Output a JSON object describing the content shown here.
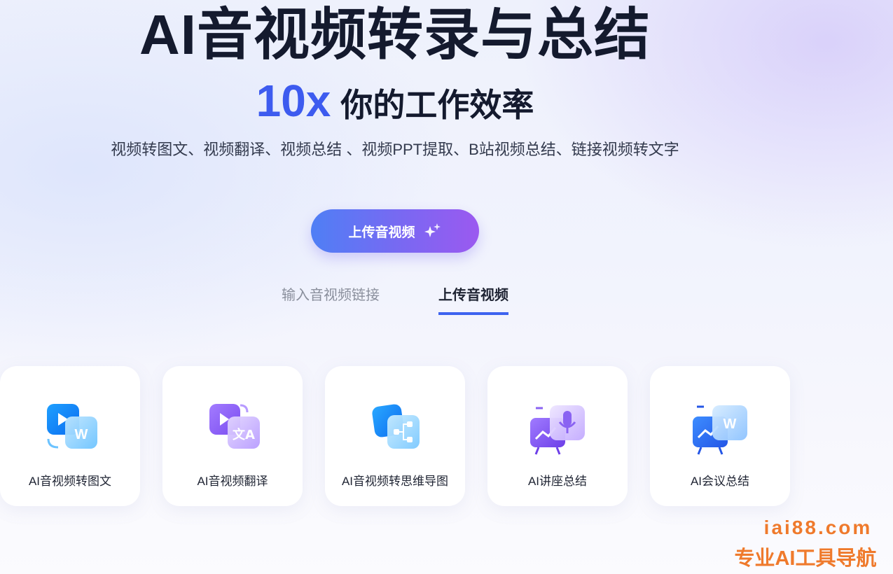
{
  "hero": {
    "title": "AI音视频转录与总结",
    "accent": "10x",
    "subtitle": "你的工作效率",
    "description": "视频转图文、视频翻译、视频总结 、视频PPT提取、B站视频总结、链接视频转文字"
  },
  "upload_button": {
    "label": "上传音视频",
    "icon": "sparkle-icon"
  },
  "tabs": [
    {
      "label": "输入音视频链接",
      "active": false
    },
    {
      "label": "上传音视频",
      "active": true
    }
  ],
  "cards": [
    {
      "label": "AI音视频转图文",
      "icon": "video-to-doc-icon"
    },
    {
      "label": "AI音视频翻译",
      "icon": "video-translate-icon"
    },
    {
      "label": "AI音视频转思维导图",
      "icon": "mindmap-icon"
    },
    {
      "label": "AI讲座总结",
      "icon": "lecture-mic-icon"
    },
    {
      "label": "AI会议总结",
      "icon": "meeting-doc-icon"
    }
  ],
  "watermark": {
    "url": "iai88.com",
    "text": "专业AI工具导航"
  },
  "colors": {
    "accent_blue": "#3d5bef",
    "button_start": "#4f7ff5",
    "button_end": "#9b59f0",
    "watermark": "#ef7a2c"
  }
}
